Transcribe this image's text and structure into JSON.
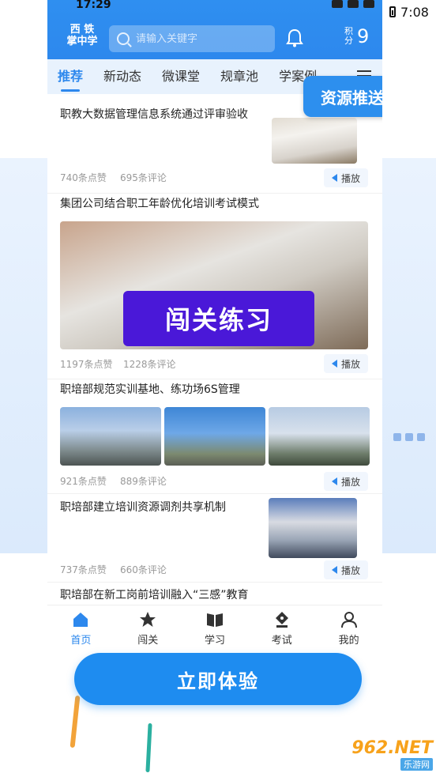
{
  "system": {
    "time_left": "17:29",
    "time_right": "7:08"
  },
  "header": {
    "logo_line1": "西 铁",
    "logo_line2": "掌中学",
    "search_placeholder": "请输入关键字",
    "points_label": "积分",
    "points_value": "9",
    "accent": "#2d88ed"
  },
  "tabs": [
    {
      "label": "推荐"
    },
    {
      "label": "新动态"
    },
    {
      "label": "微课堂"
    },
    {
      "label": "规章池"
    },
    {
      "label": "学案例"
    }
  ],
  "feed": [
    {
      "title": "职教大数据管理信息系统通过评审验收",
      "likes": "740条点赞",
      "comments": "695条评论",
      "play": "播放"
    },
    {
      "title": "集团公司结合职工年龄优化培训考试模式",
      "likes": "1197条点赞",
      "comments": "1228条评论",
      "play": "播放"
    },
    {
      "title": "职培部规范实训基地、练功场6S管理",
      "likes": "921条点赞",
      "comments": "889条评论",
      "play": "播放"
    },
    {
      "title": "职培部建立培训资源调剂共享机制",
      "likes": "737条点赞",
      "comments": "660条评论",
      "play": "播放"
    },
    {
      "title": "职培部在新工岗前培训融入“三感”教育"
    }
  ],
  "overlays": {
    "push": "资源推送",
    "challenge": "闯关练习"
  },
  "bottom_nav": [
    {
      "label": "首页",
      "icon": "home-icon"
    },
    {
      "label": "闯关",
      "icon": "star-icon"
    },
    {
      "label": "学习",
      "icon": "book-icon"
    },
    {
      "label": "考试",
      "icon": "pen-icon"
    },
    {
      "label": "我的",
      "icon": "user-icon"
    }
  ],
  "cta": "立即体验",
  "watermark": {
    "top": "962.NET",
    "bottom": "乐游网"
  }
}
